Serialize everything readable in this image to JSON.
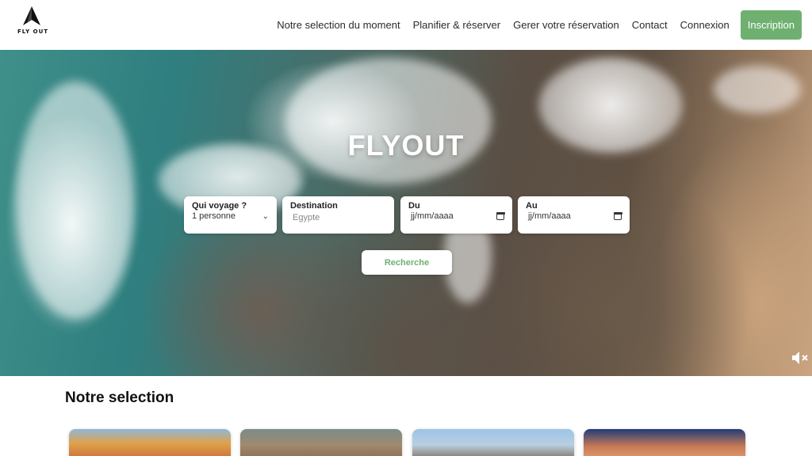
{
  "brand": {
    "logo_text": "FLY OUT",
    "logo_icon": "paper-plane-icon"
  },
  "nav": {
    "links": [
      "Notre selection du moment",
      "Planifier & réserver",
      "Gerer votre réservation",
      "Contact",
      "Connexion"
    ],
    "cta": "Inscription"
  },
  "hero": {
    "title": "FLYOUT",
    "fields": {
      "who": {
        "label": "Qui voyage ?",
        "value": "1 personne"
      },
      "destination": {
        "label": "Destination",
        "placeholder": "Egypte"
      },
      "from": {
        "label": "Du",
        "value": "jj/mm/aaaa"
      },
      "to": {
        "label": "Au",
        "value": "jj/mm/aaaa"
      }
    },
    "search_label": "Recherche",
    "mute_icon": "speaker-muted-icon"
  },
  "selection": {
    "title": "Notre selection"
  },
  "colors": {
    "accent": "#6fb071"
  }
}
